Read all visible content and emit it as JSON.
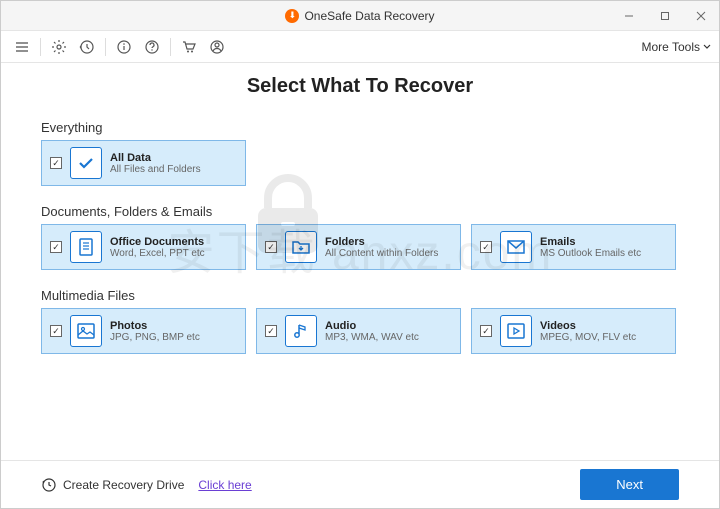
{
  "titlebar": {
    "app_name": "OneSafe Data Recovery"
  },
  "toolbar": {
    "more_tools": "More Tools"
  },
  "page": {
    "title": "Select What To Recover"
  },
  "sections": {
    "everything": {
      "label": "Everything",
      "card": {
        "title": "All Data",
        "sub": "All Files and Folders"
      }
    },
    "docs": {
      "label": "Documents, Folders & Emails",
      "cards": [
        {
          "title": "Office Documents",
          "sub": "Word, Excel, PPT etc"
        },
        {
          "title": "Folders",
          "sub": "All Content within Folders"
        },
        {
          "title": "Emails",
          "sub": "MS Outlook Emails etc"
        }
      ]
    },
    "media": {
      "label": "Multimedia Files",
      "cards": [
        {
          "title": "Photos",
          "sub": "JPG, PNG, BMP etc"
        },
        {
          "title": "Audio",
          "sub": "MP3, WMA, WAV etc"
        },
        {
          "title": "Videos",
          "sub": "MPEG, MOV, FLV etc"
        }
      ]
    }
  },
  "footer": {
    "recovery_drive": "Create Recovery Drive",
    "link": "Click here",
    "next": "Next"
  },
  "watermark": "安下载  anxz.com"
}
